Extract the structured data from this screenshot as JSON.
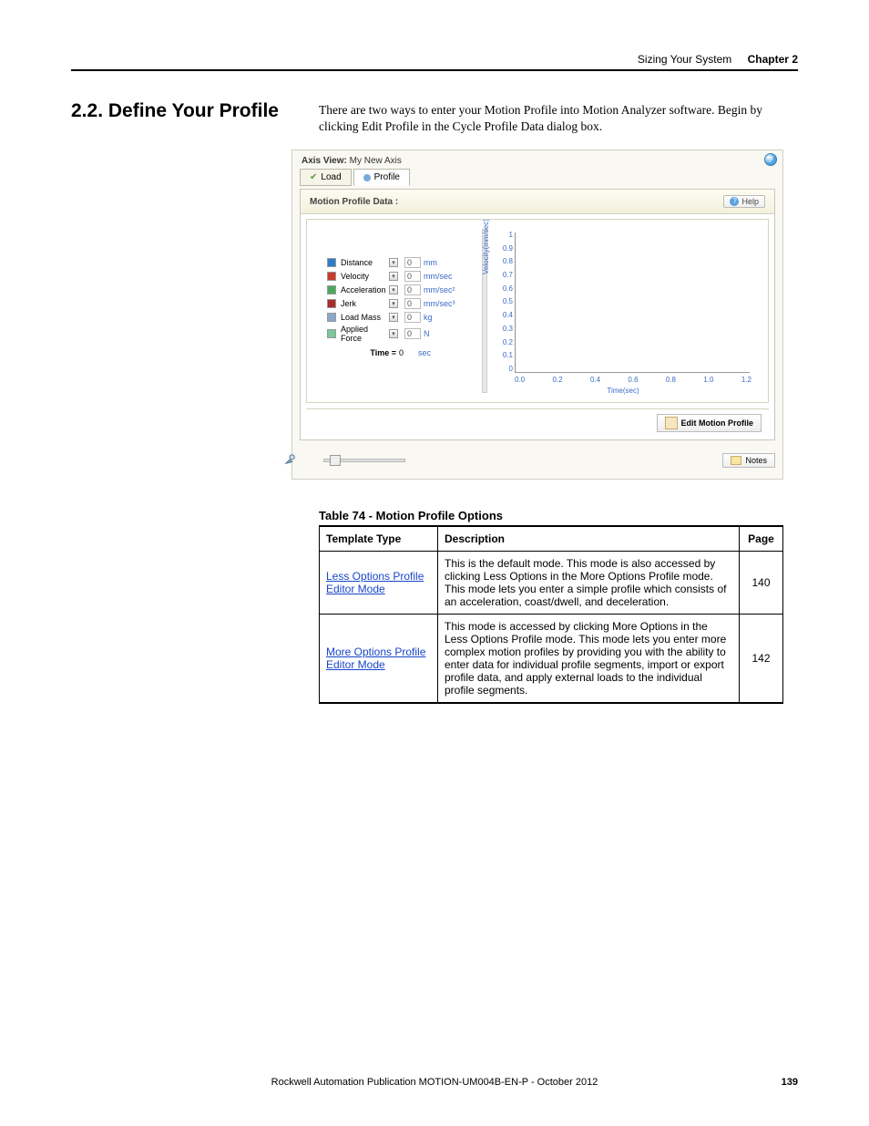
{
  "header": {
    "section": "Sizing Your System",
    "chapter": "Chapter 2"
  },
  "section_title": "2.2.  Define Your Profile",
  "intro": "There are two ways to enter your Motion Profile into Motion Analyzer software. Begin by clicking Edit Profile in the Cycle Profile Data dialog box.",
  "screenshot": {
    "axis_view_label": "Axis View:",
    "axis_view_name": "My New Axis",
    "tabs": {
      "load": "Load",
      "profile": "Profile"
    },
    "panel_title": "Motion Profile Data :",
    "help_btn": "Help",
    "legend": [
      {
        "name": "Distance",
        "color": "#2c7ec9",
        "value": "0",
        "unit": "mm"
      },
      {
        "name": "Velocity",
        "color": "#c83a2c",
        "value": "0",
        "unit": "mm/sec"
      },
      {
        "name": "Acceleration",
        "color": "#4aa85a",
        "value": "0",
        "unit": "mm/sec²"
      },
      {
        "name": "Jerk",
        "color": "#a82c2c",
        "value": "0",
        "unit": "mm/sec³"
      },
      {
        "name": "Load Mass",
        "color": "#8aa7c6",
        "value": "0",
        "unit": "kg"
      },
      {
        "name": "Applied Force",
        "color": "#7ac99a",
        "value": "0",
        "unit": "N"
      }
    ],
    "time_label": "Time =",
    "time_value": "0",
    "time_unit": "sec",
    "chart": {
      "ylabel": "Velocity(mm/sec)",
      "xlabel": "Time(sec)",
      "yticks": [
        "1",
        "0.9",
        "0.8",
        "0.7",
        "0.6",
        "0.5",
        "0.4",
        "0.3",
        "0.2",
        "0.1",
        "0"
      ],
      "xticks": [
        "0.0",
        "0.2",
        "0.4",
        "0.6",
        "0.8",
        "1.0",
        "1.2"
      ]
    },
    "edit_button": "Edit Motion Profile",
    "notes_button": "Notes"
  },
  "table": {
    "caption": "Table 74 - Motion Profile Options",
    "headers": {
      "template": "Template Type",
      "description": "Description",
      "page": "Page"
    },
    "rows": [
      {
        "template": "Less Options Profile Editor Mode",
        "description": "This is the default mode. This mode is also accessed by clicking Less Options in the More Options Profile mode. This mode lets you enter a simple profile which consists of an acceleration, coast/dwell, and deceleration.",
        "page": "140"
      },
      {
        "template": "More Options Profile Editor Mode",
        "description": "This mode is accessed by clicking More Options in the Less Options Profile mode. This mode lets you enter more complex motion profiles by providing you with the ability to enter data for individual profile segments, import or export profile data, and apply external loads to the individual profile segments.",
        "page": "142"
      }
    ]
  },
  "footer": {
    "publication": "Rockwell Automation Publication MOTION-UM004B-EN-P - October 2012",
    "page": "139"
  },
  "chart_data": {
    "type": "line",
    "title": "",
    "xlabel": "Time(sec)",
    "ylabel": "Velocity(mm/sec)",
    "xlim": [
      0.0,
      1.2
    ],
    "ylim": [
      0,
      1
    ],
    "series": [
      {
        "name": "Velocity",
        "x": [],
        "y": []
      }
    ],
    "note": "empty profile — no data plotted"
  }
}
